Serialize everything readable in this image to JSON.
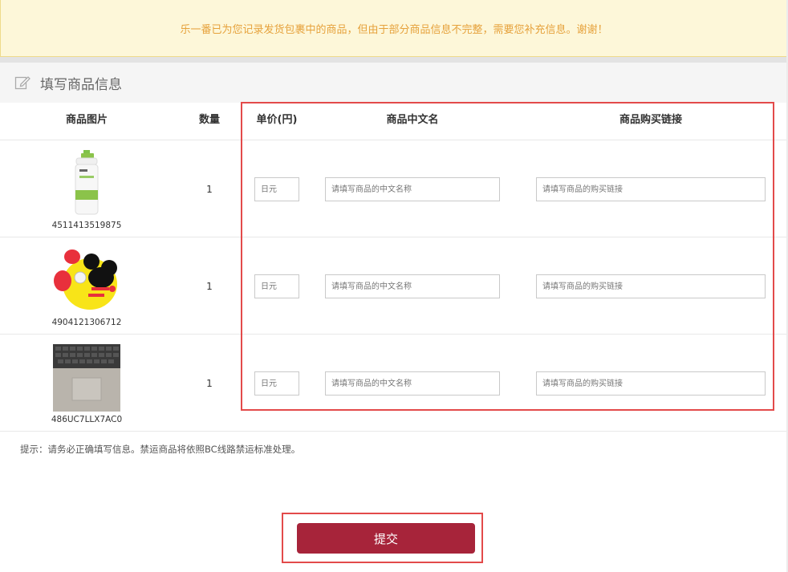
{
  "notice": {
    "text": "乐一番已为您记录发货包裹中的商品，但由于部分商品信息不完整，需要您补充信息。谢谢！"
  },
  "section": {
    "title": "填写商品信息",
    "icon": "edit-icon"
  },
  "table": {
    "headers": {
      "image": "商品图片",
      "quantity": "数量",
      "price": "单价(円)",
      "name_cn": "商品中文名",
      "link": "商品购买链接"
    },
    "rows": [
      {
        "code": "4511413519875",
        "qty": "1",
        "image": "lotion-bottle-image",
        "price_placeholder": "日元",
        "name_placeholder": "请填写商品的中文名称",
        "link_placeholder": "请填写商品的购买链接"
      },
      {
        "code": "4904121306712",
        "qty": "1",
        "image": "mickey-tableware-set-image",
        "price_placeholder": "日元",
        "name_placeholder": "请填写商品的中文名称",
        "link_placeholder": "请填写商品的购买链接"
      },
      {
        "code": "486UC7LLX7AC0",
        "qty": "1",
        "image": "laptop-photo-image",
        "price_placeholder": "日元",
        "name_placeholder": "请填写商品的中文名称",
        "link_placeholder": "请填写商品的购买链接"
      }
    ]
  },
  "tip": {
    "text": "提示：请务必正确填写信息。禁运商品将依照BC线路禁运标准处理。"
  },
  "submit": {
    "label": "提交"
  },
  "colors": {
    "accent": "#a7243a",
    "notice_bg": "#fdf7d9",
    "notice_text": "#e6a23c",
    "highlight": "#e34a4a"
  }
}
